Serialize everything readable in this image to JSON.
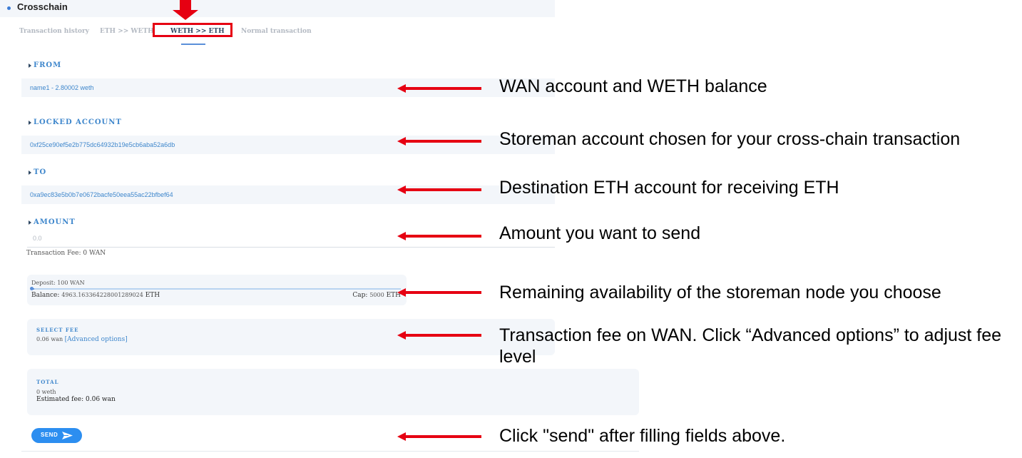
{
  "app": {
    "title": "Crosschain"
  },
  "tabs": [
    {
      "label": "Transaction history",
      "active": false
    },
    {
      "label": "ETH >> WETH",
      "active": false
    },
    {
      "label": "WETH >> ETH",
      "active": true
    },
    {
      "label": "Normal transaction",
      "active": false
    }
  ],
  "form": {
    "from": {
      "label": "FROM",
      "value": "name1 - 2.80002 weth"
    },
    "locked": {
      "label": "LOCKED ACCOUNT",
      "value": "0xf25ce90ef5e2b775dc64932b19e5cb6aba52a6db"
    },
    "to": {
      "label": "TO",
      "value": "0xa9ec83e5b0b7e0672bacfe50eea55ac22bfbef64"
    },
    "amount": {
      "label": "AMOUNT",
      "placeholder": "0.0"
    },
    "transaction_fee": "Transaction Fee: 0 WAN"
  },
  "storeman": {
    "deposit": "Deposit: 100 WAN",
    "balance_label": "Balance:",
    "balance_value": "4963.163364228001289024",
    "balance_unit": "ETH",
    "cap_label": "Cap:",
    "cap_value": "5000",
    "cap_unit": "ETH",
    "progress_fraction": 0.007
  },
  "select_fee": {
    "label": "SELECT FEE",
    "value": "0.06 wan",
    "advanced": "[Advanced options]"
  },
  "total": {
    "label": "TOTAL",
    "value": "0 weth",
    "estimated_fee": "Estimated fee: 0.06 wan"
  },
  "send": {
    "label": "SEND"
  },
  "annotations": [
    "WAN account and WETH balance",
    "Storeman account chosen for your cross-chain transaction",
    "Destination ETH account for receiving ETH",
    "Amount you want to send",
    "Remaining availability of the storeman node you choose",
    "Transaction fee on WAN. Click “Advanced options” to adjust fee level",
    "Click \"send\" after filling fields above."
  ],
  "colors": {
    "accent": "#3f87cc",
    "annotation_red": "#e60012",
    "send_button": "#2c8ef0"
  }
}
